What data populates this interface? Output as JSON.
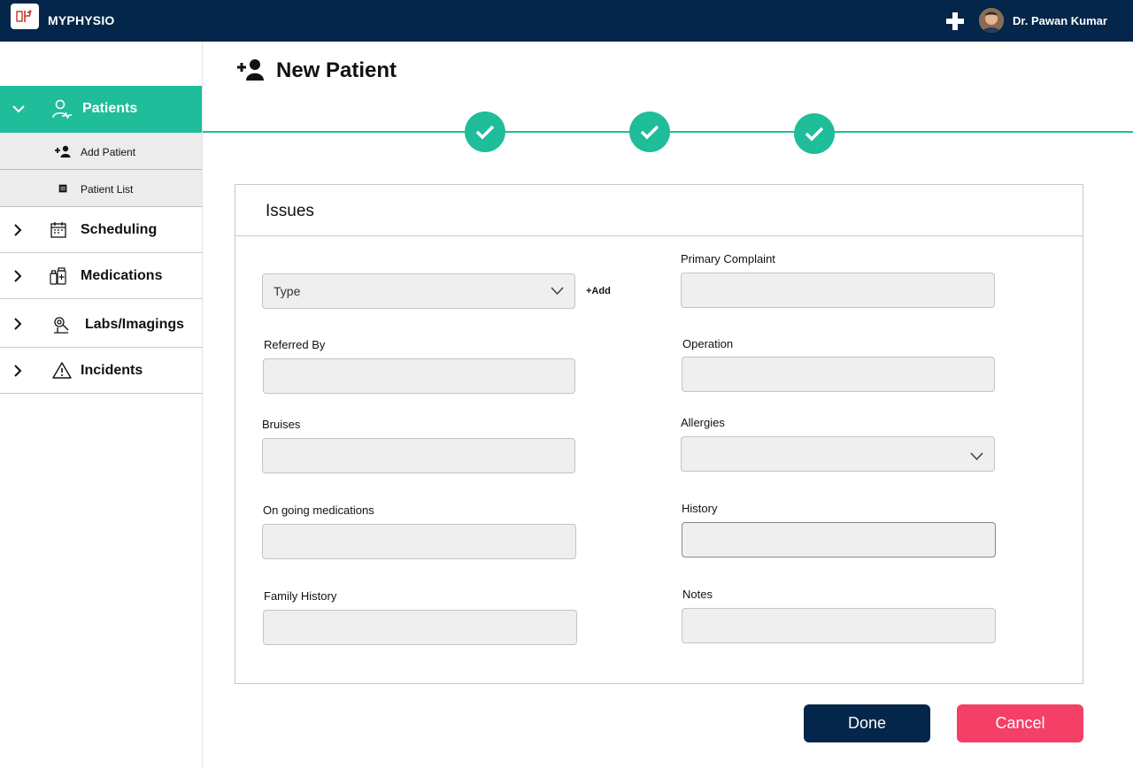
{
  "app": {
    "name": "MYPHYSIO"
  },
  "user": {
    "name": "Dr. Pawan Kumar"
  },
  "sidebar": {
    "active": {
      "label": "Patients"
    },
    "sub_items": [
      {
        "label": "Add Patient"
      },
      {
        "label": "Patient List"
      }
    ],
    "items": [
      {
        "label": "Scheduling"
      },
      {
        "label": "Medications"
      },
      {
        "label": "Labs/Imagings"
      },
      {
        "label": "Incidents"
      }
    ]
  },
  "page": {
    "title": "New Patient"
  },
  "stepper": {
    "steps_completed": 3,
    "steps_total": 3
  },
  "card": {
    "title": "Issues",
    "type_select": {
      "value": "Type",
      "add_label": "+Add"
    },
    "left_fields": [
      {
        "label": "Referred By",
        "value": ""
      },
      {
        "label": "Bruises",
        "value": ""
      },
      {
        "label": "On going medications",
        "value": ""
      },
      {
        "label": "Family History",
        "value": ""
      }
    ],
    "right_fields": [
      {
        "label": "Primary Complaint",
        "value": ""
      },
      {
        "label": "Operation",
        "value": ""
      },
      {
        "label": "Allergies",
        "value": ""
      },
      {
        "label": "History",
        "value": ""
      },
      {
        "label": "Notes",
        "value": ""
      }
    ]
  },
  "actions": {
    "done": "Done",
    "cancel": "Cancel"
  },
  "colors": {
    "navy": "#03264a",
    "teal": "#1fbd99",
    "cancel": "#f43f66"
  }
}
